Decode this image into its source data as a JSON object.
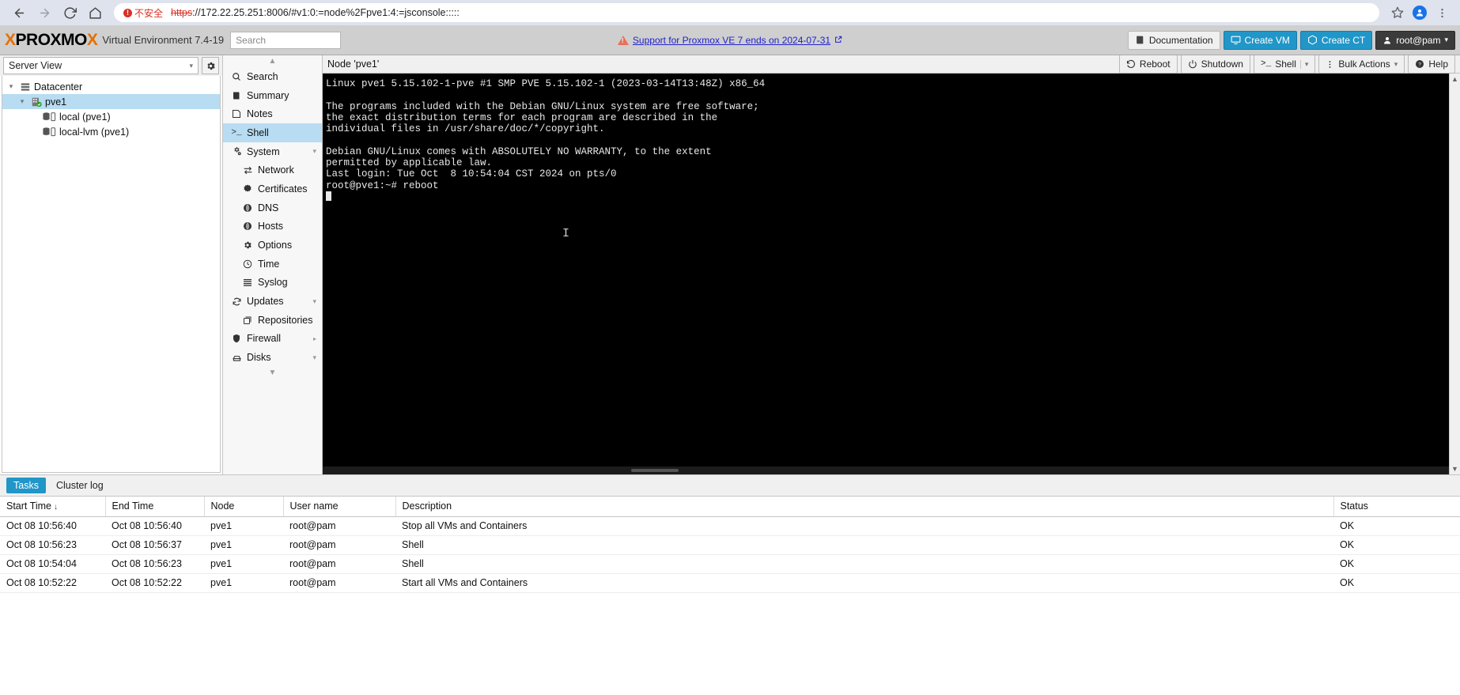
{
  "browser": {
    "back_icon": "back-arrow-icon",
    "forward_icon": "forward-arrow-icon",
    "reload_icon": "reload-icon",
    "home_icon": "home-icon",
    "security_label": "不安全",
    "url_scheme": "https",
    "url_rest": "://172.22.25.251:8006/#v1:0:=node%2Fpve1:4:=jsconsole:::::",
    "bookmark_icon": "star-icon",
    "profile_icon": "profile-avatar-icon",
    "menu_icon": "three-dots-menu-icon"
  },
  "header": {
    "logo_x1": "X",
    "logo_mid": "PROXMO",
    "logo_x2": "X",
    "product": "Virtual Environment 7.4-19",
    "search_placeholder": "Search",
    "search_value": "",
    "banner_text": "Support for Proxmox VE 7 ends on 2024-07-31",
    "documentation": "Documentation",
    "create_vm": "Create VM",
    "create_ct": "Create CT",
    "user": "root@pam"
  },
  "sidebar": {
    "view_label": "Server View",
    "tree": [
      {
        "label": "Datacenter",
        "icon": "datacenter-icon",
        "depth": 0,
        "expanded": true,
        "selected": false
      },
      {
        "label": "pve1",
        "icon": "node-icon",
        "depth": 1,
        "expanded": true,
        "selected": true
      },
      {
        "label": "local (pve1)",
        "icon": "storage-icon",
        "depth": 2,
        "expanded": false,
        "selected": false
      },
      {
        "label": "local-lvm (pve1)",
        "icon": "storage-icon",
        "depth": 2,
        "expanded": false,
        "selected": false
      }
    ]
  },
  "nav": {
    "items": [
      {
        "label": "Search",
        "icon": "search-icon",
        "sub": false,
        "selected": false,
        "caret": ""
      },
      {
        "label": "Summary",
        "icon": "summary-book-icon",
        "sub": false,
        "selected": false,
        "caret": ""
      },
      {
        "label": "Notes",
        "icon": "notes-icon",
        "sub": false,
        "selected": false,
        "caret": ""
      },
      {
        "label": "Shell",
        "icon": "shell-prompt-icon",
        "sub": false,
        "selected": true,
        "caret": ""
      },
      {
        "label": "System",
        "icon": "system-gears-icon",
        "sub": false,
        "selected": false,
        "caret": "down"
      },
      {
        "label": "Network",
        "icon": "network-arrows-icon",
        "sub": true,
        "selected": false,
        "caret": ""
      },
      {
        "label": "Certificates",
        "icon": "certificate-icon",
        "sub": true,
        "selected": false,
        "caret": ""
      },
      {
        "label": "DNS",
        "icon": "dns-globe-icon",
        "sub": true,
        "selected": false,
        "caret": ""
      },
      {
        "label": "Hosts",
        "icon": "hosts-globe-icon",
        "sub": true,
        "selected": false,
        "caret": ""
      },
      {
        "label": "Options",
        "icon": "options-gear-icon",
        "sub": true,
        "selected": false,
        "caret": ""
      },
      {
        "label": "Time",
        "icon": "clock-icon",
        "sub": true,
        "selected": false,
        "caret": ""
      },
      {
        "label": "Syslog",
        "icon": "syslog-list-icon",
        "sub": true,
        "selected": false,
        "caret": ""
      },
      {
        "label": "Updates",
        "icon": "updates-refresh-icon",
        "sub": false,
        "selected": false,
        "caret": "down"
      },
      {
        "label": "Repositories",
        "icon": "repositories-icon",
        "sub": true,
        "selected": false,
        "caret": ""
      },
      {
        "label": "Firewall",
        "icon": "firewall-shield-icon",
        "sub": false,
        "selected": false,
        "caret": "right"
      },
      {
        "label": "Disks",
        "icon": "disks-icon",
        "sub": false,
        "selected": false,
        "caret": "down"
      }
    ]
  },
  "content_header": {
    "title": "Node 'pve1'",
    "reboot": "Reboot",
    "shutdown": "Shutdown",
    "shell": "Shell",
    "bulk_actions": "Bulk Actions",
    "help": "Help"
  },
  "terminal": {
    "lines": [
      "Linux pve1 5.15.102-1-pve #1 SMP PVE 5.15.102-1 (2023-03-14T13:48Z) x86_64",
      "",
      "The programs included with the Debian GNU/Linux system are free software;",
      "the exact distribution terms for each program are described in the",
      "individual files in /usr/share/doc/*/copyright.",
      "",
      "Debian GNU/Linux comes with ABSOLUTELY NO WARRANTY, to the extent",
      "permitted by applicable law.",
      "Last login: Tue Oct  8 10:54:04 CST 2024 on pts/0",
      "root@pve1:~# reboot"
    ]
  },
  "bottom": {
    "tabs": [
      {
        "label": "Tasks",
        "active": true
      },
      {
        "label": "Cluster log",
        "active": false
      }
    ],
    "columns": [
      "Start Time",
      "End Time",
      "Node",
      "User name",
      "Description",
      "Status"
    ],
    "sort_column": "Start Time",
    "sort_dir": "↓",
    "rows": [
      {
        "start": "Oct 08 10:56:40",
        "end": "Oct 08 10:56:40",
        "node": "pve1",
        "user": "root@pam",
        "desc": "Stop all VMs and Containers",
        "status": "OK"
      },
      {
        "start": "Oct 08 10:56:23",
        "end": "Oct 08 10:56:37",
        "node": "pve1",
        "user": "root@pam",
        "desc": "Shell",
        "status": "OK"
      },
      {
        "start": "Oct 08 10:54:04",
        "end": "Oct 08 10:56:23",
        "node": "pve1",
        "user": "root@pam",
        "desc": "Shell",
        "status": "OK"
      },
      {
        "start": "Oct 08 10:52:22",
        "end": "Oct 08 10:52:22",
        "node": "pve1",
        "user": "root@pam",
        "desc": "Start all VMs and Containers",
        "status": "OK"
      }
    ]
  },
  "colors": {
    "accent_blue": "#2196c8",
    "selection_blue": "#b8dcf2",
    "brand_orange": "#e57000",
    "warning_red": "#d93025",
    "link_blue": "#2222cc"
  }
}
